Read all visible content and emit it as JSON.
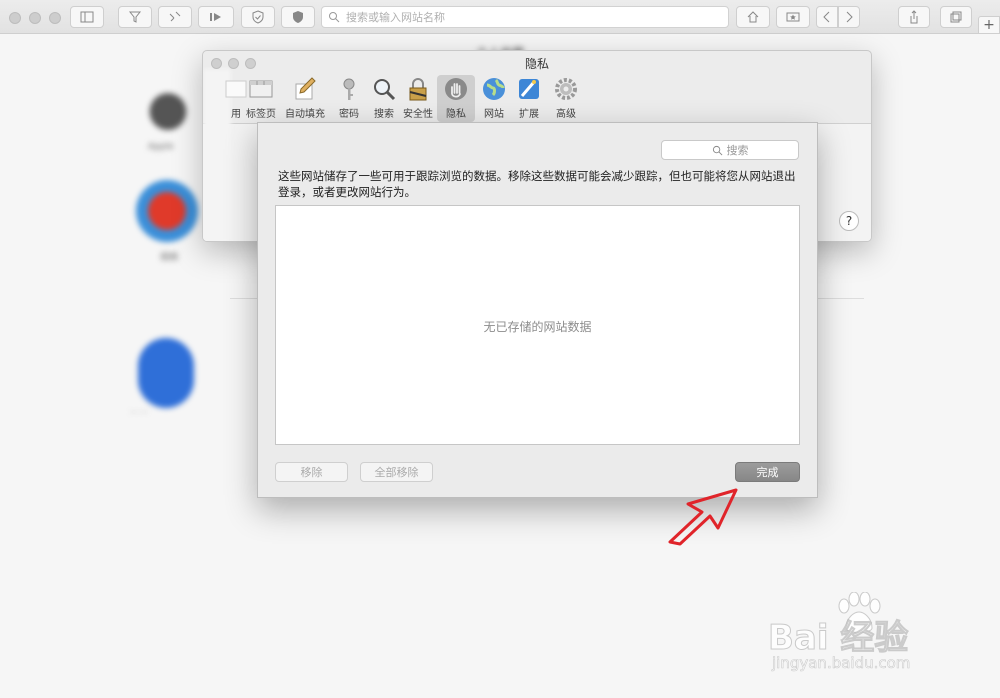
{
  "browser": {
    "address_placeholder": "搜索或输入网站名称"
  },
  "background": {
    "section_title": "个人收藏"
  },
  "prefs": {
    "title": "隐私",
    "tabs": [
      {
        "label": "用",
        "icon": "general-icon"
      },
      {
        "label": "标签页",
        "icon": "tabs-icon"
      },
      {
        "label": "自动填充",
        "icon": "autofill-icon"
      },
      {
        "label": "密码",
        "icon": "key-icon"
      },
      {
        "label": "搜索",
        "icon": "magnifier-icon"
      },
      {
        "label": "安全性",
        "icon": "lock-icon"
      },
      {
        "label": "隐私",
        "icon": "hand-icon",
        "active": true
      },
      {
        "label": "网站",
        "icon": "globe-icon"
      },
      {
        "label": "扩展",
        "icon": "puzzle-icon"
      },
      {
        "label": "高级",
        "icon": "gear-icon"
      }
    ],
    "help_label": "?"
  },
  "sheet": {
    "search_placeholder": "搜索",
    "description": "这些网站储存了一些可用于跟踪浏览的数据。移除这些数据可能会减少跟踪，但也可能将您从网站退出登录，或者更改网站行为。",
    "empty_text": "无已存储的网站数据",
    "remove_label": "移除",
    "remove_all_label": "全部移除",
    "done_label": "完成"
  },
  "watermark": {
    "brand": "Bai  经验",
    "url": "jingyan.baidu.com"
  },
  "colors": {
    "done_button": "#8e8e8e",
    "arrow": "#e0242a"
  }
}
